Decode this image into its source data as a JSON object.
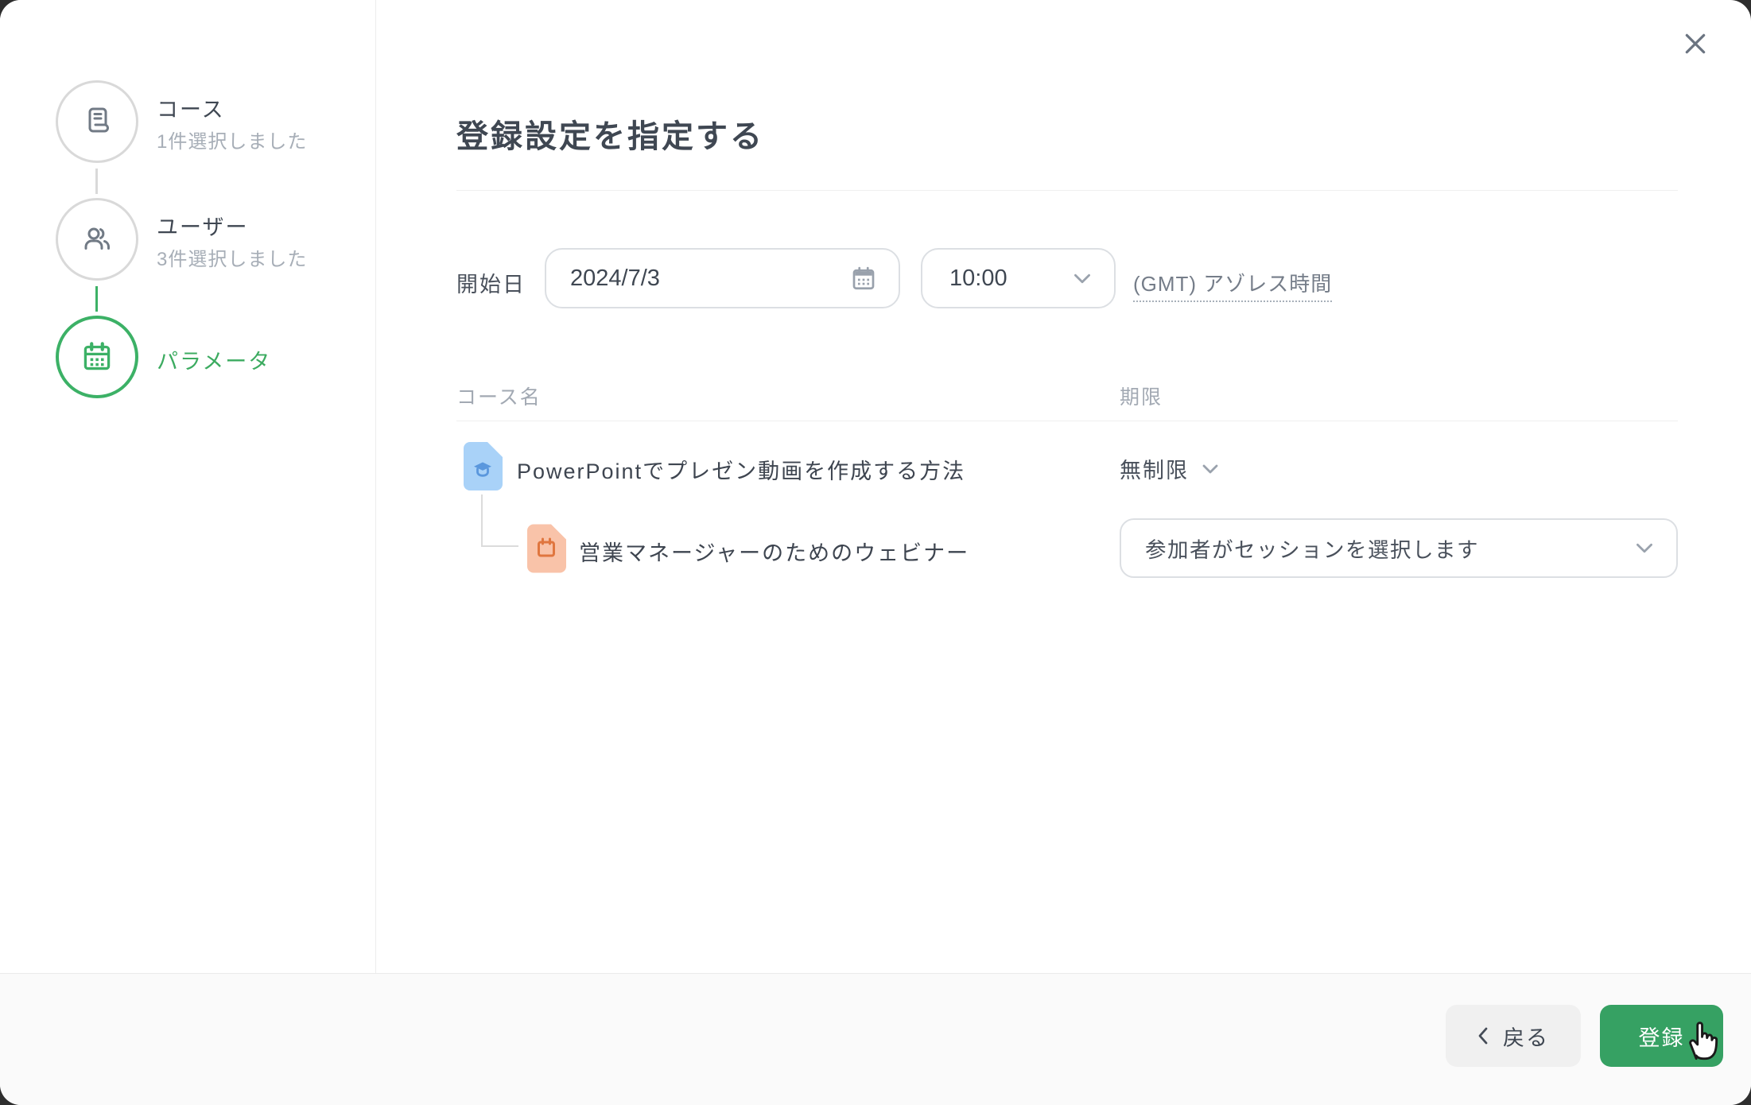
{
  "modal": {
    "title": "登録設定を指定する"
  },
  "sidebar": {
    "steps": [
      {
        "label": "コース",
        "sublabel": "1件選択しました",
        "icon": "document-icon",
        "state": "done"
      },
      {
        "label": "ユーザー",
        "sublabel": "3件選択しました",
        "icon": "users-icon",
        "state": "done"
      },
      {
        "label": "パラメータ",
        "sublabel": "",
        "icon": "calendar-icon",
        "state": "active"
      }
    ]
  },
  "form": {
    "start_date_label": "開始日",
    "start_date_value": "2024/7/3",
    "time_value": "10:00",
    "timezone_link": "(GMT) アゾレス時間"
  },
  "table": {
    "course_header": "コース名",
    "deadline_header": "期限",
    "rows": [
      {
        "icon": "course-file-icon",
        "title": "PowerPointでプレゼン動画を作成する方法",
        "deadline": "無制限"
      },
      {
        "icon": "session-file-icon",
        "title": "営業マネージャーのためのウェビナー",
        "deadline_select": "参加者がセッションを選択します"
      }
    ]
  },
  "footer": {
    "back_label": "戻る",
    "submit_label": "登録"
  },
  "colors": {
    "accent_green": "#36a163",
    "stepper_green": "#3cb166",
    "course_icon_bg": "#a9d2f8",
    "course_icon_fg": "#5a97dd",
    "session_icon_bg": "#f9c3a9",
    "session_icon_fg": "#e0763f",
    "border_gray": "#dcdfe3",
    "text_dark": "#3f4752",
    "text_muted": "#a2a9b3"
  }
}
